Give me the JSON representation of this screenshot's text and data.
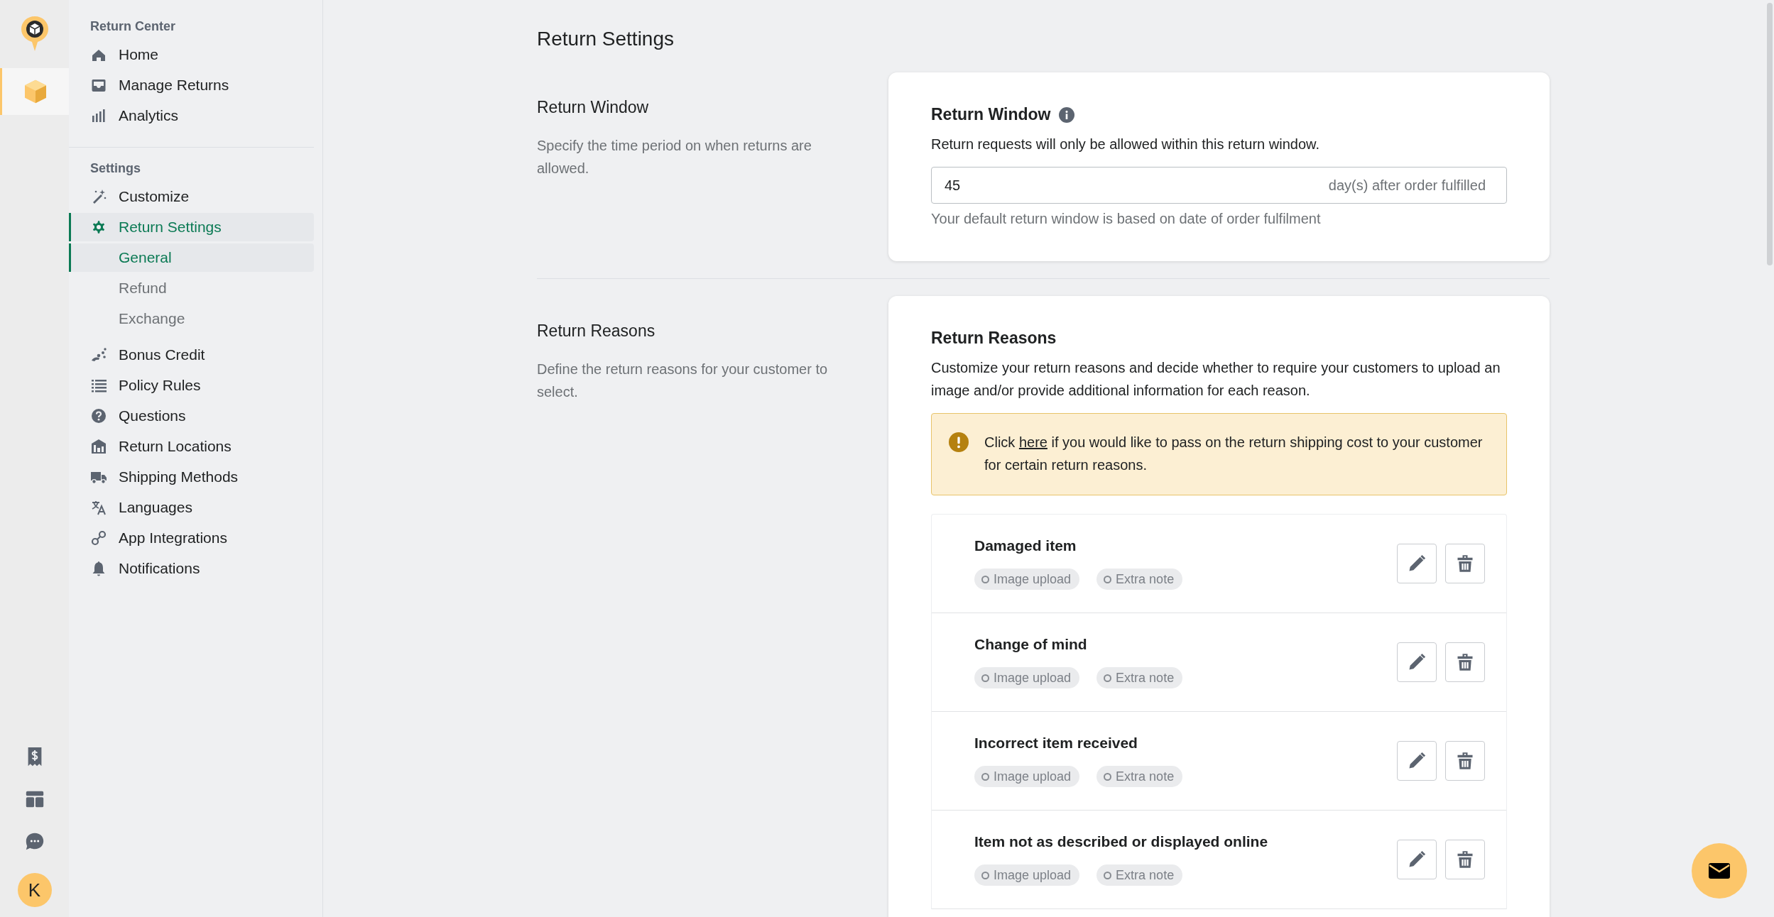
{
  "rail": {
    "top_items": [
      {
        "selected": true
      }
    ],
    "avatar": "K"
  },
  "sidebar": {
    "sections": [
      {
        "heading": "Return Center",
        "items": [
          {
            "label": "Home",
            "selected": false
          },
          {
            "label": "Manage Returns",
            "selected": false
          },
          {
            "label": "Analytics",
            "selected": false
          }
        ]
      },
      {
        "heading": "Settings",
        "items": [
          {
            "label": "Customize",
            "selected": false
          },
          {
            "label": "Return Settings",
            "selected": true,
            "children": [
              {
                "label": "General",
                "selected": true
              },
              {
                "label": "Refund",
                "selected": false
              },
              {
                "label": "Exchange",
                "selected": false
              }
            ]
          },
          {
            "label": "Bonus Credit",
            "selected": false
          },
          {
            "label": "Policy Rules",
            "selected": false
          },
          {
            "label": "Questions",
            "selected": false
          },
          {
            "label": "Return Locations",
            "selected": false
          },
          {
            "label": "Shipping Methods",
            "selected": false
          },
          {
            "label": "Languages",
            "selected": false
          },
          {
            "label": "App Integrations",
            "selected": false
          },
          {
            "label": "Notifications",
            "selected": false
          }
        ]
      }
    ]
  },
  "page": {
    "title": "Return Settings",
    "sections": [
      {
        "kind": "window",
        "title": "Return Window",
        "description": "Specify the time period on when returns are allowed.",
        "card": {
          "title": "Return Window",
          "text": "Return requests will only be allowed within this return window.",
          "field": {
            "value": "45",
            "suffix": "day(s) after order fulfilled"
          },
          "help": "Your default return window is based on date of order fulfilment"
        }
      },
      {
        "kind": "reasons",
        "title": "Return Reasons",
        "description": "Define the return reasons for your customer to select.",
        "card": {
          "title": "Return Reasons",
          "text": "Customize your return reasons and decide whether to require your customers to upload an image and/or provide additional information for each reason.",
          "alert": {
            "before": "Click ",
            "link": "here",
            "after": " if you would like to pass on the return shipping cost to your customer for certain return reasons."
          },
          "reasons": [
            {
              "name": "Damaged item",
              "tags": [
                {
                  "label": "Image upload",
                  "enabled": false
                },
                {
                  "label": "Extra note",
                  "enabled": false
                }
              ]
            },
            {
              "name": "Change of mind",
              "tags": [
                {
                  "label": "Image upload",
                  "enabled": false
                },
                {
                  "label": "Extra note",
                  "enabled": false
                }
              ]
            },
            {
              "name": "Incorrect item received",
              "tags": [
                {
                  "label": "Image upload",
                  "enabled": false
                },
                {
                  "label": "Extra note",
                  "enabled": false
                }
              ]
            },
            {
              "name": "Item not as described or displayed online",
              "tags": [
                {
                  "label": "Image upload",
                  "enabled": false
                },
                {
                  "label": "Extra note",
                  "enabled": false
                }
              ]
            }
          ]
        }
      }
    ]
  }
}
